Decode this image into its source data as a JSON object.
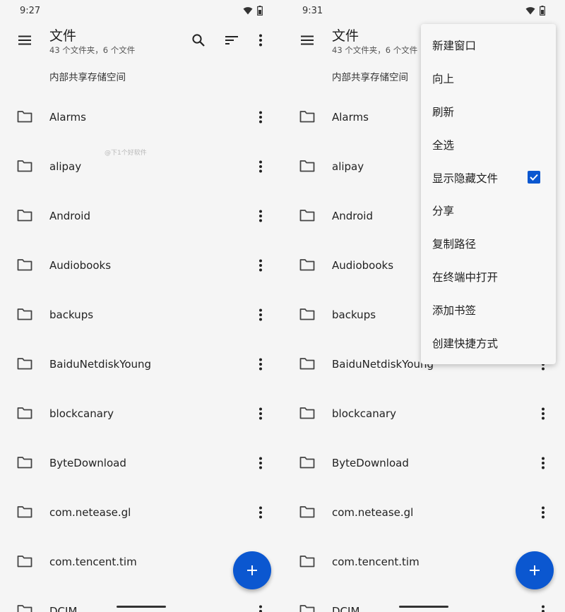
{
  "status": {
    "time_left": "9:27",
    "time_right": "9:31"
  },
  "appbar": {
    "title": "文件",
    "subtitle": "43 个文件夹，6 个文件"
  },
  "breadcrumb": "内部共享存储空间",
  "watermark": "@下1个好软件",
  "files": [
    "Alarms",
    "alipay",
    "Android",
    "Audiobooks",
    "backups",
    "BaiduNetdiskYoung",
    "blockcanary",
    "ByteDownload",
    "com.netease.gl",
    "com.tencent.tim",
    "DCIM"
  ],
  "menu": {
    "items": [
      "新建窗口",
      "向上",
      "刷新",
      "全选",
      "显示隐藏文件",
      "分享",
      "复制路径",
      "在终端中打开",
      "添加书签",
      "创建快捷方式"
    ],
    "show_hidden_checked": true
  },
  "colors": {
    "accent": "#0b57d0",
    "background": "#f5f5f5"
  },
  "icons": [
    "menu-icon",
    "search-icon",
    "sort-icon",
    "more-vert-icon",
    "folder-icon",
    "add-icon",
    "wifi-icon",
    "battery-icon",
    "check-icon"
  ]
}
